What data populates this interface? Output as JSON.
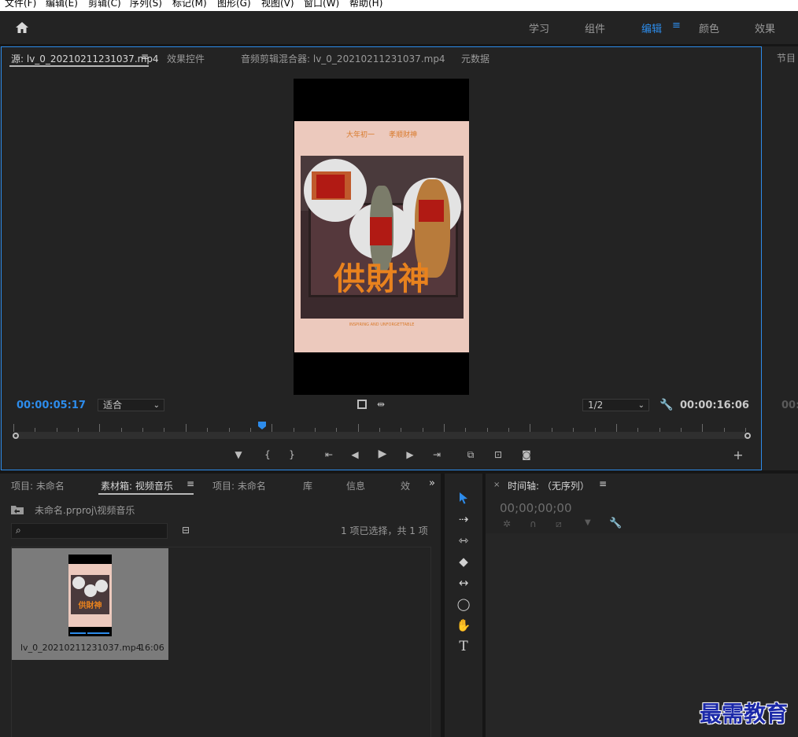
{
  "menu": [
    "文件(F)",
    "编辑(E)",
    "剪辑(C)",
    "序列(S)",
    "标记(M)",
    "图形(G)",
    "视图(V)",
    "窗口(W)",
    "帮助(H)"
  ],
  "workspaces": [
    {
      "label": "学习",
      "active": false
    },
    {
      "label": "组件",
      "active": false
    },
    {
      "label": "编辑",
      "active": true
    },
    {
      "label": "颜色",
      "active": false
    },
    {
      "label": "效果",
      "active": false
    }
  ],
  "source_tabs": [
    {
      "label": "源: lv_0_20210211231037.mp4",
      "active": true
    },
    {
      "label": "效果控件",
      "active": false
    },
    {
      "label": "音频剪辑混合器: lv_0_20210211231037.mp4",
      "active": false
    },
    {
      "label": "元数据",
      "active": false
    }
  ],
  "program_tab": "节目",
  "poster": {
    "top_line": "大年初一　　孝顺财神",
    "title": "供財神",
    "bottom_line": "INSPIRING AND UNFORGETTABLE"
  },
  "source": {
    "current_time": "00:00:05:17",
    "fit_value": "适合",
    "resolution_value": "1/2",
    "duration": "00:00:16:06",
    "playhead_fraction": 0.34,
    "program_time_partial": "00:"
  },
  "colors": {
    "accent": "#2d8ceb",
    "panel_bg": "#232323",
    "poster_bg": "#ecc9bd",
    "title_orange": "#e8821e"
  },
  "project_tabs": [
    {
      "label": "项目: 未命名",
      "active": false
    },
    {
      "label": "素材箱: 视频音乐",
      "active": true
    },
    {
      "label": "项目: 未命名",
      "active": false
    },
    {
      "label": "库",
      "active": false
    },
    {
      "label": "信息",
      "active": false
    },
    {
      "label": "效",
      "active": false
    }
  ],
  "bin": {
    "path": "未命名.prproj\\视频音乐",
    "search_placeholder": "",
    "selection_status": "1 项已选择，共 1 项",
    "clip_name": "lv_0_20210211231037.mp4",
    "clip_duration": "16:06"
  },
  "tools": [
    "selection-tool",
    "track-select-tool",
    "ripple-edit-tool",
    "razor-tool",
    "slip-tool",
    "ellipse-tool",
    "hand-tool",
    "type-tool"
  ],
  "timeline": {
    "title": "时间轴: （无序列）",
    "timecode": "00;00;00;00"
  },
  "watermark": "最需教育"
}
